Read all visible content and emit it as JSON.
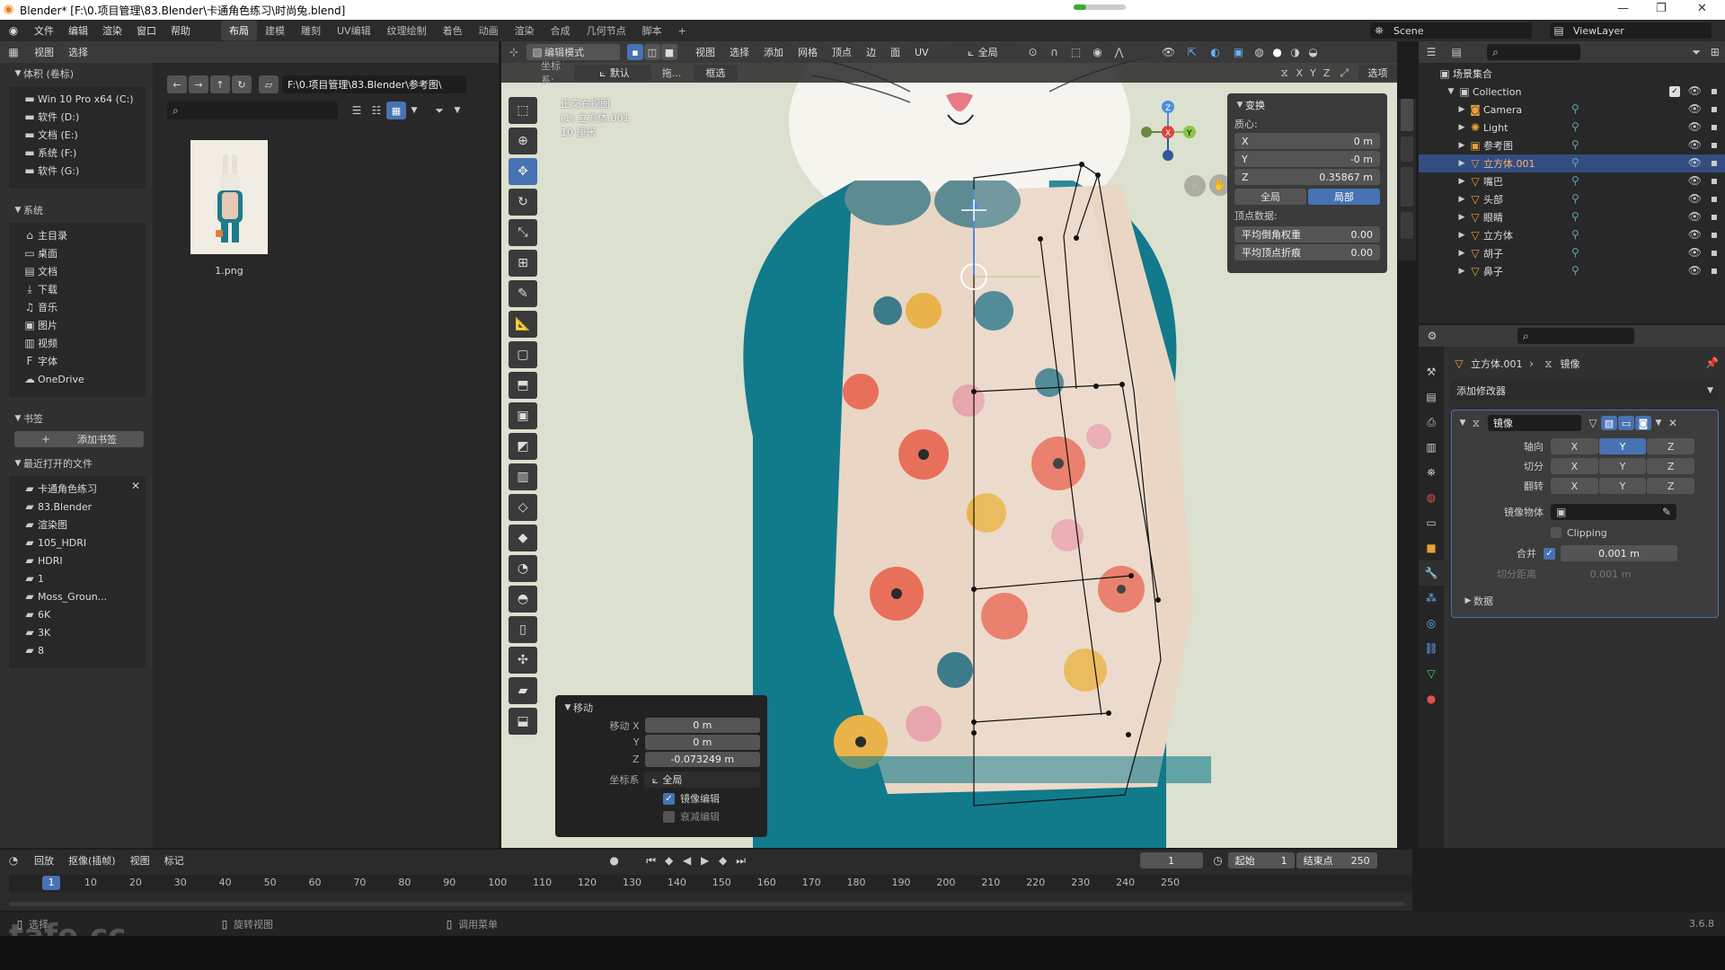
{
  "window": {
    "title": "Blender* [F:\\0.项目管理\\83.Blender\\卡通角色练习\\时尚兔.blend]",
    "controls": [
      "—",
      "❐",
      "✕"
    ]
  },
  "menubar": {
    "menus": [
      "文件",
      "编辑",
      "渲染",
      "窗口",
      "帮助"
    ],
    "workspaces": [
      "布局",
      "建模",
      "雕刻",
      "UV编辑",
      "纹理绘制",
      "着色",
      "动画",
      "渲染",
      "合成",
      "几何节点",
      "脚本"
    ],
    "add_tab": "+",
    "scene": "Scene",
    "view_layer": "ViewLayer"
  },
  "filebrowser": {
    "header_menus": [
      "视图",
      "选择"
    ],
    "path": "F:\\0.项目管理\\83.Blender\\参考图\\",
    "sections": {
      "volumes_title": "体积 (卷标)",
      "volumes": [
        "Win 10 Pro x64 (C:)",
        "软件 (D:)",
        "文档 (E:)",
        "系统 (F:)",
        "软件 (G:)"
      ],
      "system_title": "系统",
      "system": [
        "主目录",
        "桌面",
        "文档",
        "下载",
        "音乐",
        "图片",
        "视频",
        "字体",
        "OneDrive"
      ],
      "bookmarks_title": "书签",
      "add_bookmark": "添加书签",
      "recent_title": "最近打开的文件",
      "recent": [
        "卡通角色练习",
        "83.Blender",
        "渲染图",
        "105_HDRI",
        "HDRI",
        "1",
        "Moss_Groun...",
        "6K",
        "3K",
        "8"
      ]
    },
    "thumbnail_name": "1.png"
  },
  "viewport": {
    "mode": "编辑模式",
    "menus": [
      "视图",
      "选择",
      "添加",
      "网格",
      "顶点",
      "边",
      "面",
      "UV"
    ],
    "transform_orientation": "全局",
    "coord_label": "坐标系:",
    "coord_value": "默认",
    "drag_label": "拖...",
    "select_mode": "框选",
    "axes": [
      "X",
      "Y",
      "Z"
    ],
    "options": "选项",
    "overlay_text": [
      "正交右视图",
      "(1) 立方体.001",
      "10 厘米"
    ]
  },
  "transform_panel": {
    "title": "变换",
    "median_label": "质心:",
    "x": "0 m",
    "y": "-0 m",
    "z": "0.35867 m",
    "global": "全局",
    "local": "局部",
    "vertex_data": "顶点数据:",
    "bevel_weight_label": "平均倒角权重",
    "bevel_weight": "0.00",
    "crease_label": "平均顶点折痕",
    "crease": "0.00"
  },
  "move_operator": {
    "title": "移动",
    "move_x_label": "移动 X",
    "move_x": "0 m",
    "y_label": "Y",
    "y": "0 m",
    "z_label": "Z",
    "z": "-0.073249 m",
    "coord_label": "坐标系",
    "coord_value": "全局",
    "mirror_edit": "镜像编辑",
    "mirror_checked": true,
    "proportional": "衰减编辑",
    "proportional_checked": false
  },
  "outliner": {
    "root": "场景集合",
    "collection": "Collection",
    "items": [
      {
        "name": "Camera",
        "icon": "camera-icon",
        "color": "#e8a13a"
      },
      {
        "name": "Light",
        "icon": "light-icon",
        "color": "#e8a13a"
      },
      {
        "name": "参考图",
        "icon": "image-icon",
        "color": "#e8a13a"
      },
      {
        "name": "立方体.001",
        "icon": "mesh-icon",
        "color": "#e8a13a",
        "selected": true
      },
      {
        "name": "嘴巴",
        "icon": "mesh-icon",
        "color": "#e8a13a"
      },
      {
        "name": "头部",
        "icon": "mesh-icon",
        "color": "#e8a13a"
      },
      {
        "name": "眼睛",
        "icon": "mesh-icon",
        "color": "#e8a13a"
      },
      {
        "name": "立方体",
        "icon": "mesh-icon",
        "color": "#e8a13a"
      },
      {
        "name": "胡子",
        "icon": "mesh-icon",
        "color": "#e8a13a"
      },
      {
        "name": "鼻子",
        "icon": "mesh-icon",
        "color": "#e8a13a"
      }
    ]
  },
  "properties": {
    "object": "立方体.001",
    "modifier_crumb": "镜像",
    "add_modifier": "添加修改器",
    "modifier_name": "镜像",
    "axis_label": "轴向",
    "bisect_label": "切分",
    "flip_label": "翻转",
    "xyz": [
      "X",
      "Y",
      "Z"
    ],
    "active_axis": "Y",
    "mirror_object_label": "镜像物体",
    "clipping": "Clipping",
    "merge_label": "合并",
    "merge_value": "0.001 m",
    "bisect_distance_label": "切分距离",
    "bisect_distance": "0.001 m",
    "data": "数据"
  },
  "timeline": {
    "menus": [
      "回放",
      "抠像(插帧)",
      "视图",
      "标记"
    ],
    "current_frame": "1",
    "start_label": "起始",
    "start": "1",
    "end_label": "结束点",
    "end": "250",
    "ticks": [
      "1",
      "10",
      "20",
      "30",
      "40",
      "50",
      "60",
      "70",
      "80",
      "90",
      "100",
      "110",
      "120",
      "130",
      "140",
      "150",
      "160",
      "170",
      "180",
      "190",
      "200",
      "210",
      "220",
      "230",
      "240",
      "250"
    ]
  },
  "statusbar": {
    "items": [
      "选择",
      "旋转视图",
      "调用菜单"
    ],
    "version": "3.6.8",
    "watermark": "tafe.cc"
  }
}
